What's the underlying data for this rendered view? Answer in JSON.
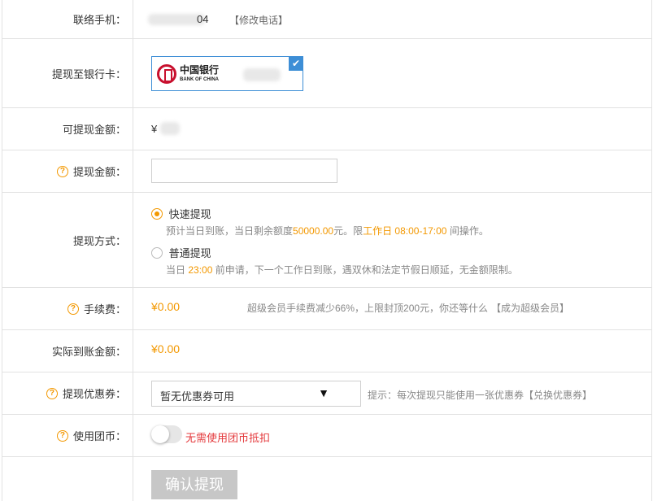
{
  "phone": {
    "label": "联络手机：",
    "value_suffix": "04",
    "edit_link": "【修改电话】"
  },
  "bank": {
    "label": "提现至银行卡：",
    "bank_name_cn": "中国银行",
    "bank_name_en": "BANK OF CHINA"
  },
  "available": {
    "label": "可提现金额：",
    "currency": "¥"
  },
  "amount": {
    "label": "提现金额：",
    "value": "",
    "placeholder": ""
  },
  "method": {
    "label": "提现方式：",
    "fast": {
      "label": "快速提现",
      "desc_prefix": "预计当日到账，当日剩余额度",
      "desc_quota": "50000.00",
      "desc_mid": "元。限",
      "desc_time": "工作日 08:00-17:00",
      "desc_suffix": " 间操作。"
    },
    "normal": {
      "label": "普通提现",
      "desc_prefix": "当日 ",
      "desc_time": "23:00",
      "desc_suffix": " 前申请，下一个工作日到账，遇双休和法定节假日顺延，无金额限制。"
    }
  },
  "fee": {
    "label": "手续费：",
    "value": "¥0.00",
    "promo": "超级会员手续费减少66%，上限封顶200元，你还等什么",
    "promo_link": "【成为超级会员】"
  },
  "actual": {
    "label": "实际到账金额：",
    "value": "¥0.00"
  },
  "coupon": {
    "label": "提现优惠券：",
    "selected": "暂无优惠券可用",
    "hint": "提示：每次提现只能使用一张优惠券",
    "hint_link": "【兑换优惠券】"
  },
  "coin": {
    "label": "使用团币：",
    "status": "无需使用团币抵扣"
  },
  "submit": {
    "label": "确认提现"
  },
  "colors": {
    "accent": "#f39800",
    "link_blue": "#3d8ed6",
    "warning_red": "#e4393c",
    "button_disabled": "#c7c7c7"
  }
}
